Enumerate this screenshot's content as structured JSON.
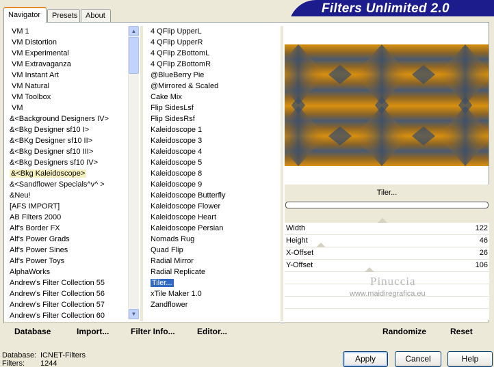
{
  "tabs": [
    {
      "label": "Navigator"
    },
    {
      "label": "Presets"
    },
    {
      "label": "About"
    }
  ],
  "banner": {
    "title": "Filters Unlimited 2.0"
  },
  "categories": [
    "VM 1",
    "VM Distortion",
    "VM Experimental",
    "VM Extravaganza",
    "VM Instant Art",
    "VM Natural",
    "VM Toolbox",
    "VM",
    "&<Background Designers IV>",
    "&<Bkg Designer sf10 I>",
    "&<BKg Designer sf10 II>",
    "&<Bkg Designer sf10 III>",
    "&<Bkg Designers sf10 IV>",
    "&<Bkg Kaleidoscope>",
    "&<Sandflower Specials^v^ >",
    "&Neu!",
    "[AFS IMPORT]",
    "AB Filters 2000",
    "Alf's Border FX",
    "Alf's Power Grads",
    "Alf's Power Sines",
    "Alf's Power Toys",
    "AlphaWorks",
    "Andrew's Filter Collection 55",
    "Andrew's Filter Collection 56",
    "Andrew's Filter Collection 57",
    "Andrew's Filter Collection 60"
  ],
  "filters": [
    "4 QFlip UpperL",
    "4 QFlip UpperR",
    "4 QFlip ZBottomL",
    "4 QFlip ZBottomR",
    "@BlueBerry Pie",
    "@Mirrored & Scaled",
    "Cake Mix",
    "Flip SidesLsf",
    "Flip SidesRsf",
    "Kaleidoscope 1",
    "Kaleidoscope 3",
    "Kaleidoscope 4",
    "Kaleidoscope 5",
    "Kaleidoscope 8",
    "Kaleidoscope 9",
    "Kaleidoscope Butterfly",
    "Kaleidoscope Flower",
    "Kaleidoscope Heart",
    "Kaleidoscope Persian",
    "Nomads Rug",
    "Quad Flip",
    "Radial Mirror",
    "Radial Replicate",
    "Tiler...",
    "xTile Maker 1.0",
    "Zandflower"
  ],
  "selected_filter_title": "Tiler...",
  "params": [
    {
      "label": "Width",
      "value": "122"
    },
    {
      "label": "Height",
      "value": "46"
    },
    {
      "label": "X-Offset",
      "value": "26"
    },
    {
      "label": "Y-Offset",
      "value": "106"
    }
  ],
  "watermark": {
    "name": "Pinuccia",
    "site": "www.maidiregrafica.eu"
  },
  "bottom_buttons": {
    "database": "Database",
    "import": "Import...",
    "filter_info": "Filter Info...",
    "editor": "Editor...",
    "randomize": "Randomize",
    "reset": "Reset"
  },
  "dialog_buttons": {
    "apply": "Apply",
    "cancel": "Cancel",
    "help": "Help"
  },
  "status": {
    "database_label": "Database:",
    "database_value": "ICNET-Filters",
    "filters_label": "Filters:",
    "filters_value": "1244"
  },
  "colors": {
    "selection": "#316ac5",
    "preview_orange": "#c07a10",
    "preview_blue": "#4a5a70",
    "banner": "#1c1c8c"
  }
}
